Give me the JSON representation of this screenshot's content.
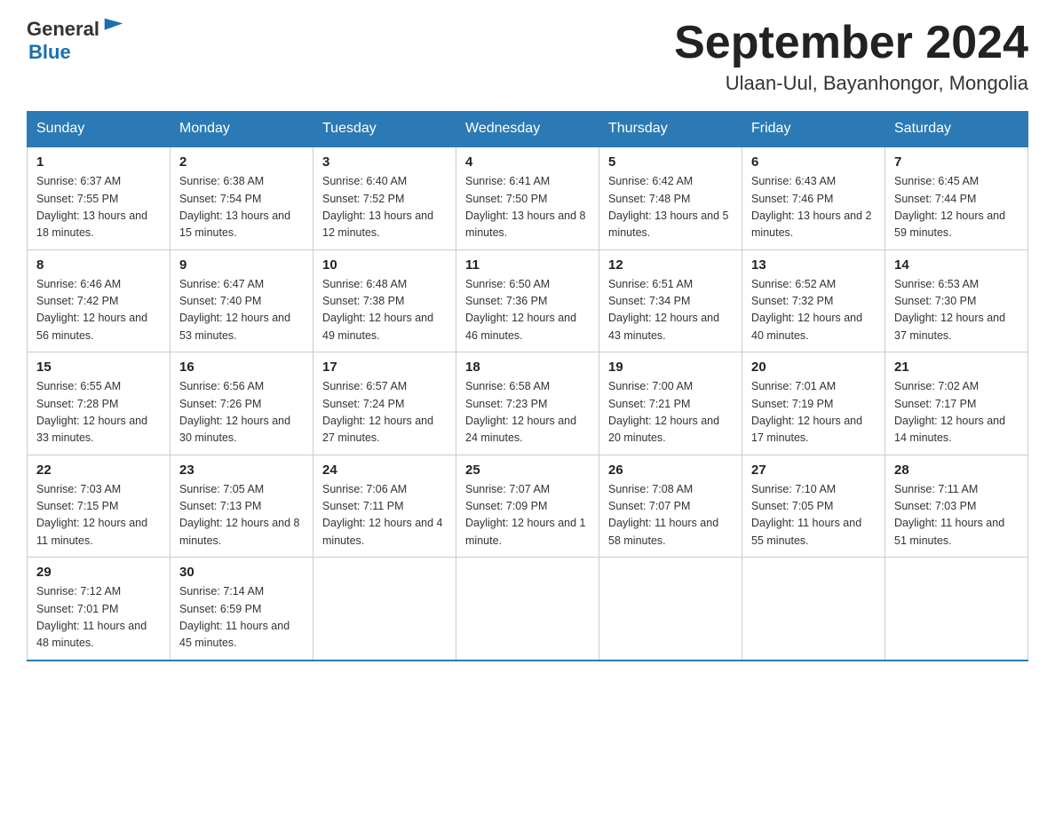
{
  "header": {
    "logo_general": "General",
    "logo_blue": "Blue",
    "month_title": "September 2024",
    "location": "Ulaan-Uul, Bayanhongor, Mongolia"
  },
  "weekdays": [
    "Sunday",
    "Monday",
    "Tuesday",
    "Wednesday",
    "Thursday",
    "Friday",
    "Saturday"
  ],
  "weeks": [
    [
      {
        "day": "1",
        "sunrise": "6:37 AM",
        "sunset": "7:55 PM",
        "daylight": "13 hours and 18 minutes."
      },
      {
        "day": "2",
        "sunrise": "6:38 AM",
        "sunset": "7:54 PM",
        "daylight": "13 hours and 15 minutes."
      },
      {
        "day": "3",
        "sunrise": "6:40 AM",
        "sunset": "7:52 PM",
        "daylight": "13 hours and 12 minutes."
      },
      {
        "day": "4",
        "sunrise": "6:41 AM",
        "sunset": "7:50 PM",
        "daylight": "13 hours and 8 minutes."
      },
      {
        "day": "5",
        "sunrise": "6:42 AM",
        "sunset": "7:48 PM",
        "daylight": "13 hours and 5 minutes."
      },
      {
        "day": "6",
        "sunrise": "6:43 AM",
        "sunset": "7:46 PM",
        "daylight": "13 hours and 2 minutes."
      },
      {
        "day": "7",
        "sunrise": "6:45 AM",
        "sunset": "7:44 PM",
        "daylight": "12 hours and 59 minutes."
      }
    ],
    [
      {
        "day": "8",
        "sunrise": "6:46 AM",
        "sunset": "7:42 PM",
        "daylight": "12 hours and 56 minutes."
      },
      {
        "day": "9",
        "sunrise": "6:47 AM",
        "sunset": "7:40 PM",
        "daylight": "12 hours and 53 minutes."
      },
      {
        "day": "10",
        "sunrise": "6:48 AM",
        "sunset": "7:38 PM",
        "daylight": "12 hours and 49 minutes."
      },
      {
        "day": "11",
        "sunrise": "6:50 AM",
        "sunset": "7:36 PM",
        "daylight": "12 hours and 46 minutes."
      },
      {
        "day": "12",
        "sunrise": "6:51 AM",
        "sunset": "7:34 PM",
        "daylight": "12 hours and 43 minutes."
      },
      {
        "day": "13",
        "sunrise": "6:52 AM",
        "sunset": "7:32 PM",
        "daylight": "12 hours and 40 minutes."
      },
      {
        "day": "14",
        "sunrise": "6:53 AM",
        "sunset": "7:30 PM",
        "daylight": "12 hours and 37 minutes."
      }
    ],
    [
      {
        "day": "15",
        "sunrise": "6:55 AM",
        "sunset": "7:28 PM",
        "daylight": "12 hours and 33 minutes."
      },
      {
        "day": "16",
        "sunrise": "6:56 AM",
        "sunset": "7:26 PM",
        "daylight": "12 hours and 30 minutes."
      },
      {
        "day": "17",
        "sunrise": "6:57 AM",
        "sunset": "7:24 PM",
        "daylight": "12 hours and 27 minutes."
      },
      {
        "day": "18",
        "sunrise": "6:58 AM",
        "sunset": "7:23 PM",
        "daylight": "12 hours and 24 minutes."
      },
      {
        "day": "19",
        "sunrise": "7:00 AM",
        "sunset": "7:21 PM",
        "daylight": "12 hours and 20 minutes."
      },
      {
        "day": "20",
        "sunrise": "7:01 AM",
        "sunset": "7:19 PM",
        "daylight": "12 hours and 17 minutes."
      },
      {
        "day": "21",
        "sunrise": "7:02 AM",
        "sunset": "7:17 PM",
        "daylight": "12 hours and 14 minutes."
      }
    ],
    [
      {
        "day": "22",
        "sunrise": "7:03 AM",
        "sunset": "7:15 PM",
        "daylight": "12 hours and 11 minutes."
      },
      {
        "day": "23",
        "sunrise": "7:05 AM",
        "sunset": "7:13 PM",
        "daylight": "12 hours and 8 minutes."
      },
      {
        "day": "24",
        "sunrise": "7:06 AM",
        "sunset": "7:11 PM",
        "daylight": "12 hours and 4 minutes."
      },
      {
        "day": "25",
        "sunrise": "7:07 AM",
        "sunset": "7:09 PM",
        "daylight": "12 hours and 1 minute."
      },
      {
        "day": "26",
        "sunrise": "7:08 AM",
        "sunset": "7:07 PM",
        "daylight": "11 hours and 58 minutes."
      },
      {
        "day": "27",
        "sunrise": "7:10 AM",
        "sunset": "7:05 PM",
        "daylight": "11 hours and 55 minutes."
      },
      {
        "day": "28",
        "sunrise": "7:11 AM",
        "sunset": "7:03 PM",
        "daylight": "11 hours and 51 minutes."
      }
    ],
    [
      {
        "day": "29",
        "sunrise": "7:12 AM",
        "sunset": "7:01 PM",
        "daylight": "11 hours and 48 minutes."
      },
      {
        "day": "30",
        "sunrise": "7:14 AM",
        "sunset": "6:59 PM",
        "daylight": "11 hours and 45 minutes."
      },
      null,
      null,
      null,
      null,
      null
    ]
  ]
}
